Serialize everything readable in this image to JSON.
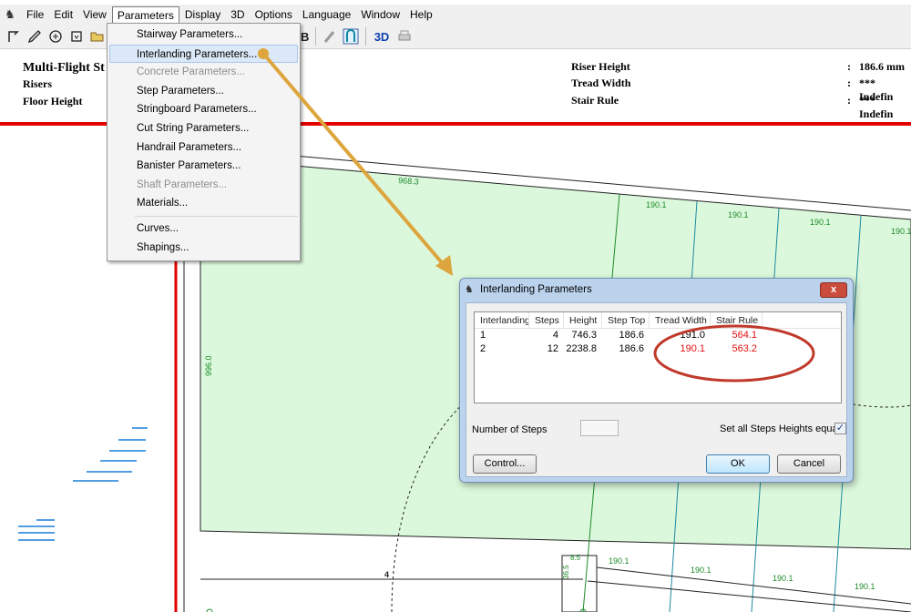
{
  "menubar": {
    "items": [
      "File",
      "Edit",
      "View",
      "Parameters",
      "Display",
      "3D",
      "Options",
      "Language",
      "Window",
      "Help"
    ],
    "open_item": "Parameters"
  },
  "toolbar": {
    "text_buttons": [
      "CB",
      "3D"
    ]
  },
  "header": {
    "title": "Multi-Flight St",
    "left_labels": [
      "Risers",
      "Floor Height"
    ],
    "right_rows": [
      {
        "label": "Riser Height",
        "sep": ":",
        "value": "186.6 mm"
      },
      {
        "label": "Tread Width",
        "sep": ":",
        "value": "*** Indefin"
      },
      {
        "label": "Stair Rule",
        "sep": ":",
        "value": "*** Indefin"
      }
    ]
  },
  "menu": {
    "items": [
      {
        "label": "Stairway Parameters...",
        "disabled": false
      },
      {
        "label": "Interlanding Parameters...",
        "disabled": false,
        "highlighted": true
      },
      {
        "label": "Concrete Parameters...",
        "disabled": true
      },
      {
        "label": "Step Parameters...",
        "disabled": false
      },
      {
        "label": "Stringboard Parameters...",
        "disabled": false
      },
      {
        "label": "Cut String Parameters...",
        "disabled": false
      },
      {
        "label": "Handrail Parameters...",
        "disabled": false
      },
      {
        "label": "Banister Parameters...",
        "disabled": false
      },
      {
        "label": "Shaft Parameters...",
        "disabled": true
      },
      {
        "label": "Materials...",
        "disabled": false
      }
    ],
    "items2": [
      {
        "label": "Curves...",
        "disabled": false
      },
      {
        "label": "Shapings...",
        "disabled": false
      }
    ]
  },
  "dialog": {
    "title": "Interlanding Parameters",
    "close_label": "x",
    "columns": [
      "Interlanding",
      "Steps",
      "Height",
      "Step Top",
      "Tread Width",
      "Stair Rule"
    ],
    "rows": [
      {
        "interlanding": "1",
        "steps": "4",
        "height": "746.3",
        "step_top": "186.6",
        "tread_width": "191.0",
        "stair_rule": "564.1",
        "tread_red": false
      },
      {
        "interlanding": "2",
        "steps": "12",
        "height": "2238.8",
        "step_top": "186.6",
        "tread_width": "190.1",
        "stair_rule": "563.2",
        "tread_red": true
      }
    ],
    "number_of_steps_label": "Number of Steps",
    "number_of_steps_value": "",
    "set_all_label": "Set all Steps Heights equal",
    "set_all_checked": true,
    "control_label": "Control...",
    "ok_label": "OK",
    "cancel_label": "Cancel"
  },
  "drawing": {
    "dimensions": [
      "968.3",
      "190.1",
      "190.1",
      "190.1",
      "190.1",
      "996.0",
      "190.1",
      "190.1",
      "190.1",
      "190.1",
      "4",
      "8.5",
      "36.5"
    ]
  },
  "colors": {
    "accent_red": "#e01010",
    "landing_fill": "#dcf8dc",
    "dim_green": "#1c8a2a",
    "arrow": "#dda53d",
    "frame_red": "#e20000"
  }
}
